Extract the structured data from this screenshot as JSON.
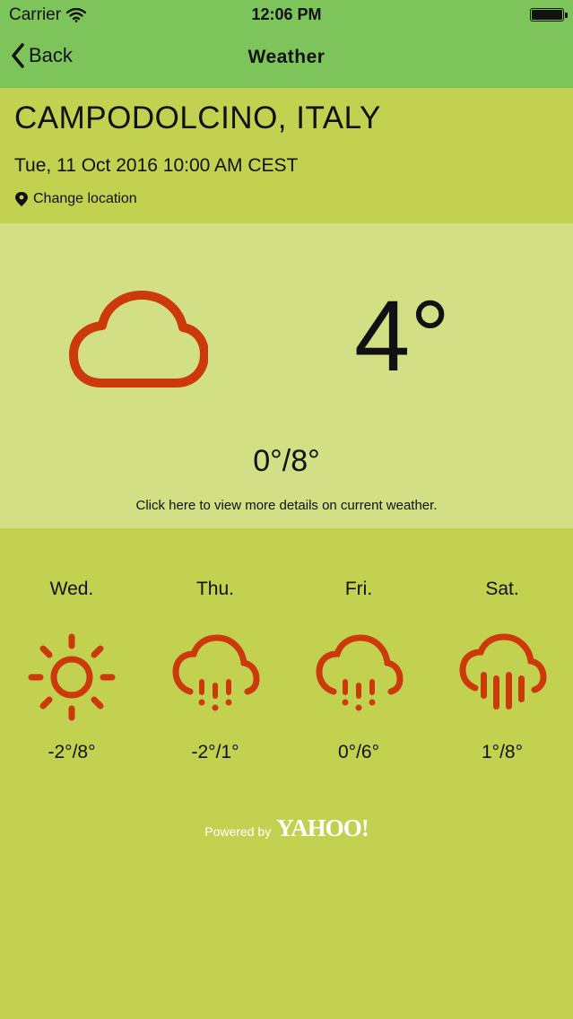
{
  "status_bar": {
    "carrier": "Carrier",
    "time": "12:06 PM"
  },
  "nav": {
    "back_label": "Back",
    "title": "Weather"
  },
  "location": {
    "city": "CAMPODOLCINO, ITALY",
    "datetime": "Tue, 11 Oct 2016 10:00 AM CEST",
    "change_label": "Change location"
  },
  "current": {
    "icon": "cloud-icon",
    "temperature": "4°",
    "range": "0°/8°",
    "hint": "Click here to view more details on current weather."
  },
  "forecast": [
    {
      "day": "Wed.",
      "icon": "sun-icon",
      "range": "-2°/8°"
    },
    {
      "day": "Thu.",
      "icon": "rain-cloud-icon",
      "range": "-2°/1°"
    },
    {
      "day": "Fri.",
      "icon": "rain-cloud-icon",
      "range": "0°/6°"
    },
    {
      "day": "Sat.",
      "icon": "heavy-rain-cloud-icon",
      "range": "1°/8°"
    }
  ],
  "footer": {
    "powered_by": "Powered by",
    "brand": "YAHOO!"
  },
  "colors": {
    "nav_bg": "#7dc55a",
    "page_bg": "#c2d14f",
    "panel_bg": "#d3df84",
    "icon": "#cc3a0c"
  }
}
